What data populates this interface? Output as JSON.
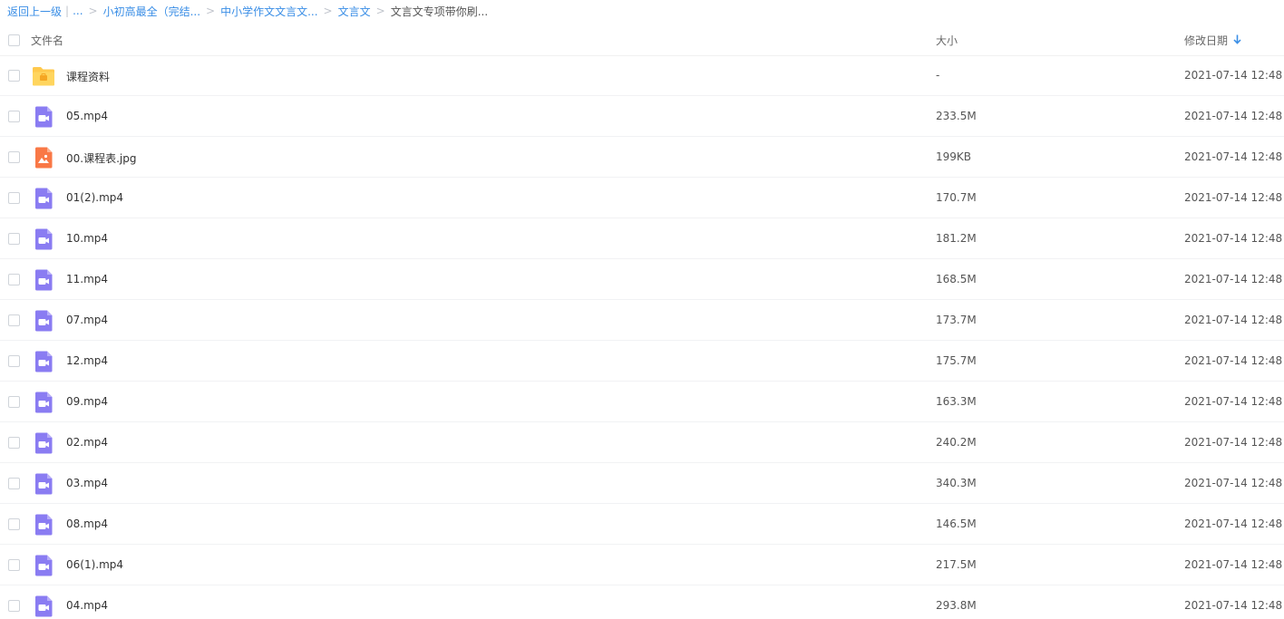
{
  "breadcrumb": {
    "back": "返回上一级",
    "ellipsis": "...",
    "crumbs": [
      "小初高最全（完结...",
      "中小学作文文言文...",
      "文言文"
    ],
    "current": "文言文专项带你刷..."
  },
  "header": {
    "name": "文件名",
    "size": "大小",
    "date": "修改日期"
  },
  "colors": {
    "link": "#3a8ee6",
    "video_icon": "#8a7cf2",
    "image_icon": "#f97846",
    "folder_icon": "#ffc94d"
  },
  "files": [
    {
      "name": "课程资料",
      "size": "-",
      "date": "2021-07-14 12:48",
      "icon": "folder-icon"
    },
    {
      "name": "05.mp4",
      "size": "233.5M",
      "date": "2021-07-14 12:48",
      "icon": "video-file-icon"
    },
    {
      "name": "00.课程表.jpg",
      "size": "199KB",
      "date": "2021-07-14 12:48",
      "icon": "image-file-icon"
    },
    {
      "name": "01(2).mp4",
      "size": "170.7M",
      "date": "2021-07-14 12:48",
      "icon": "video-file-icon"
    },
    {
      "name": "10.mp4",
      "size": "181.2M",
      "date": "2021-07-14 12:48",
      "icon": "video-file-icon"
    },
    {
      "name": "11.mp4",
      "size": "168.5M",
      "date": "2021-07-14 12:48",
      "icon": "video-file-icon"
    },
    {
      "name": "07.mp4",
      "size": "173.7M",
      "date": "2021-07-14 12:48",
      "icon": "video-file-icon"
    },
    {
      "name": "12.mp4",
      "size": "175.7M",
      "date": "2021-07-14 12:48",
      "icon": "video-file-icon"
    },
    {
      "name": "09.mp4",
      "size": "163.3M",
      "date": "2021-07-14 12:48",
      "icon": "video-file-icon"
    },
    {
      "name": "02.mp4",
      "size": "240.2M",
      "date": "2021-07-14 12:48",
      "icon": "video-file-icon"
    },
    {
      "name": "03.mp4",
      "size": "340.3M",
      "date": "2021-07-14 12:48",
      "icon": "video-file-icon"
    },
    {
      "name": "08.mp4",
      "size": "146.5M",
      "date": "2021-07-14 12:48",
      "icon": "video-file-icon"
    },
    {
      "name": "06(1).mp4",
      "size": "217.5M",
      "date": "2021-07-14 12:48",
      "icon": "video-file-icon"
    },
    {
      "name": "04.mp4",
      "size": "293.8M",
      "date": "2021-07-14 12:48",
      "icon": "video-file-icon"
    }
  ]
}
